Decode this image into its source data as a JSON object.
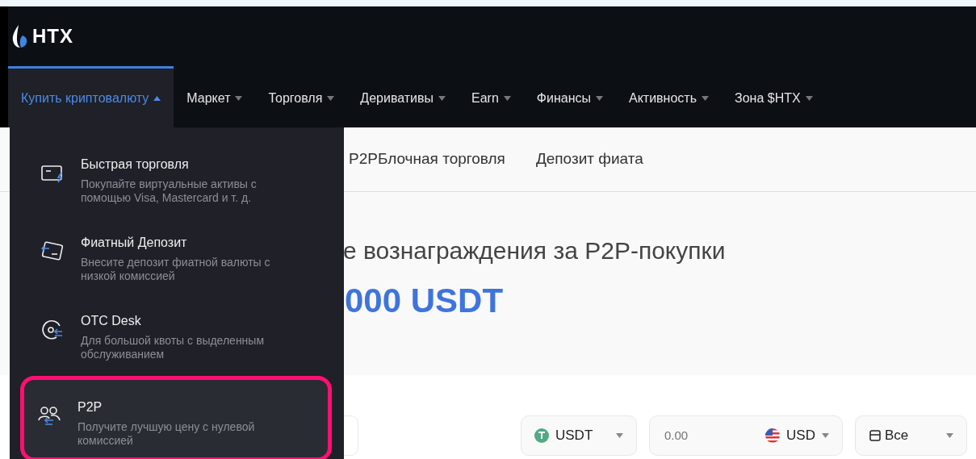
{
  "logo": {
    "text": "HTX"
  },
  "nav": [
    {
      "label": "Купить криптовалюту",
      "selected": true,
      "expanded": true
    },
    {
      "label": "Маркет",
      "selected": false,
      "expanded": false
    },
    {
      "label": "Торговля",
      "selected": false,
      "expanded": false
    },
    {
      "label": "Деривативы",
      "selected": false,
      "expanded": false
    },
    {
      "label": "Earn",
      "selected": false,
      "expanded": false
    },
    {
      "label": "Финансы",
      "selected": false,
      "expanded": false
    },
    {
      "label": "Активность",
      "selected": false,
      "expanded": false
    },
    {
      "label": "Зона $HTX",
      "selected": false,
      "expanded": false
    }
  ],
  "subnav": [
    "P2PБлочная торговля",
    "Депозит фиата"
  ],
  "hero": {
    "heading": "е вознаграждения за P2P-покупки",
    "amount": "000 USDT"
  },
  "filters": {
    "coin": "USDT",
    "amount_placeholder": "0.00",
    "currency": "USD",
    "payment": "Все"
  },
  "dropdown": {
    "items": [
      {
        "title": "Быстрая торговля",
        "description": "Покупайте виртуальные активы с помощью Visa, Mastercard и т. д.",
        "selected": false
      },
      {
        "title": "Фиатный Депозит",
        "description": "Внесите депозит фиатной валюты с низкой комиссией",
        "selected": false
      },
      {
        "title": "OTC Desk",
        "description": "Для большой квоты с выделенным обслуживанием",
        "selected": false
      },
      {
        "title": "P2P",
        "description": "Получите лучшую цену с нулевой комиссией",
        "selected": true
      }
    ]
  }
}
